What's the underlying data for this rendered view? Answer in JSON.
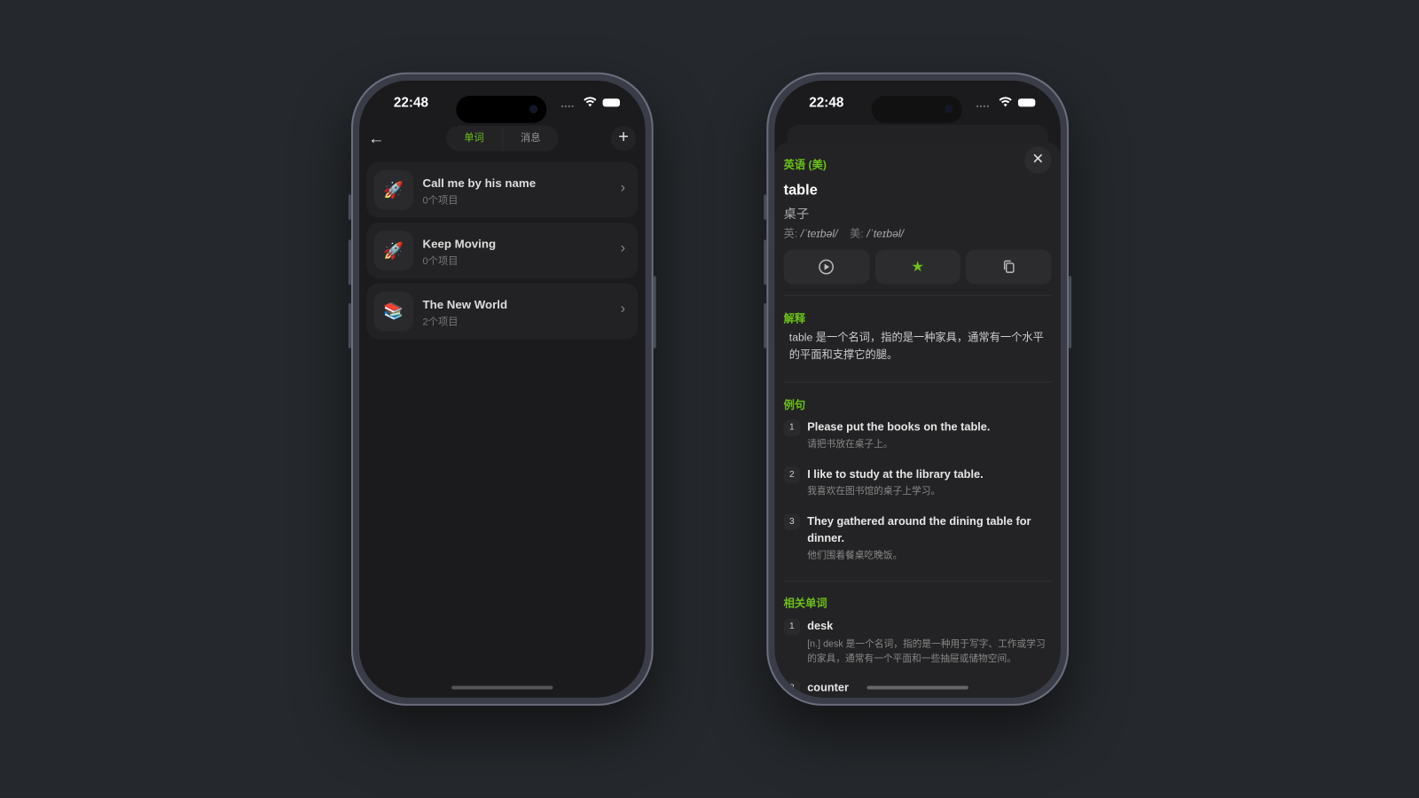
{
  "status": {
    "time": "22:48"
  },
  "left_phone": {
    "tabs": [
      {
        "label": "单词",
        "active": true
      },
      {
        "label": "消息",
        "active": false
      }
    ],
    "items": [
      {
        "title": "Call me by his name",
        "subtitle": "0个项目",
        "icon": "🚀"
      },
      {
        "title": "Keep Moving",
        "subtitle": "0个项目",
        "icon": "🚀"
      },
      {
        "title": "The New World",
        "subtitle": "2个项目",
        "icon": "📚"
      }
    ]
  },
  "right_phone": {
    "language": "英语 (美)",
    "word": "table",
    "meaning": "桌子",
    "phonetic_uk_label": "英:",
    "phonetic_uk": "/ˈteɪbəl/",
    "phonetic_us_label": "美:",
    "phonetic_us": "/ˈteɪbəl/",
    "definition_title": "解释",
    "definition": "table 是一个名词，指的是一种家具，通常有一个水平的平面和支撑它的腿。",
    "examples_title": "例句",
    "examples": [
      {
        "n": "1",
        "en": "Please put the books on the table.",
        "zh": "请把书放在桌子上。"
      },
      {
        "n": "2",
        "en": "I like to study at the library table.",
        "zh": "我喜欢在图书馆的桌子上学习。"
      },
      {
        "n": "3",
        "en": "They gathered around the dining table for dinner.",
        "zh": "他们围着餐桌吃晚饭。"
      }
    ],
    "related_title": "相关单词",
    "related": [
      {
        "n": "1",
        "word": "desk",
        "desc": "[n.] desk 是一个名词，指的是一种用于写字、工作或学习的家具，通常有一个平面和一些抽屉或储物空间。"
      },
      {
        "n": "2",
        "word": "counter"
      }
    ]
  },
  "colors": {
    "accent": "#6cc01a",
    "background": "#25282c",
    "screen": "#1b1b1d"
  }
}
